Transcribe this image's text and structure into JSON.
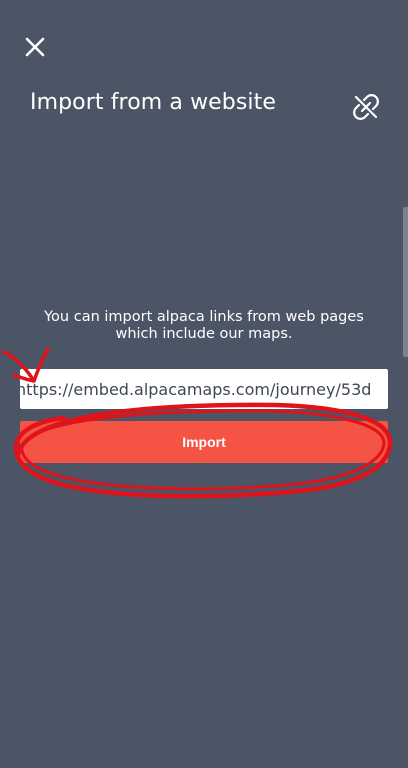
{
  "header": {
    "close_icon": "close-icon",
    "title": "Import from a website",
    "link_icon": "link-broken-icon"
  },
  "main": {
    "description": "You can import alpaca links from web pages which include our maps.",
    "url_input": {
      "value": "https://embed.alpacamaps.com/journey/53d"
    },
    "import_button": {
      "label": "Import"
    }
  },
  "colors": {
    "background": "#4c5566",
    "accent": "#f55344",
    "annotation": "#e0131b"
  }
}
